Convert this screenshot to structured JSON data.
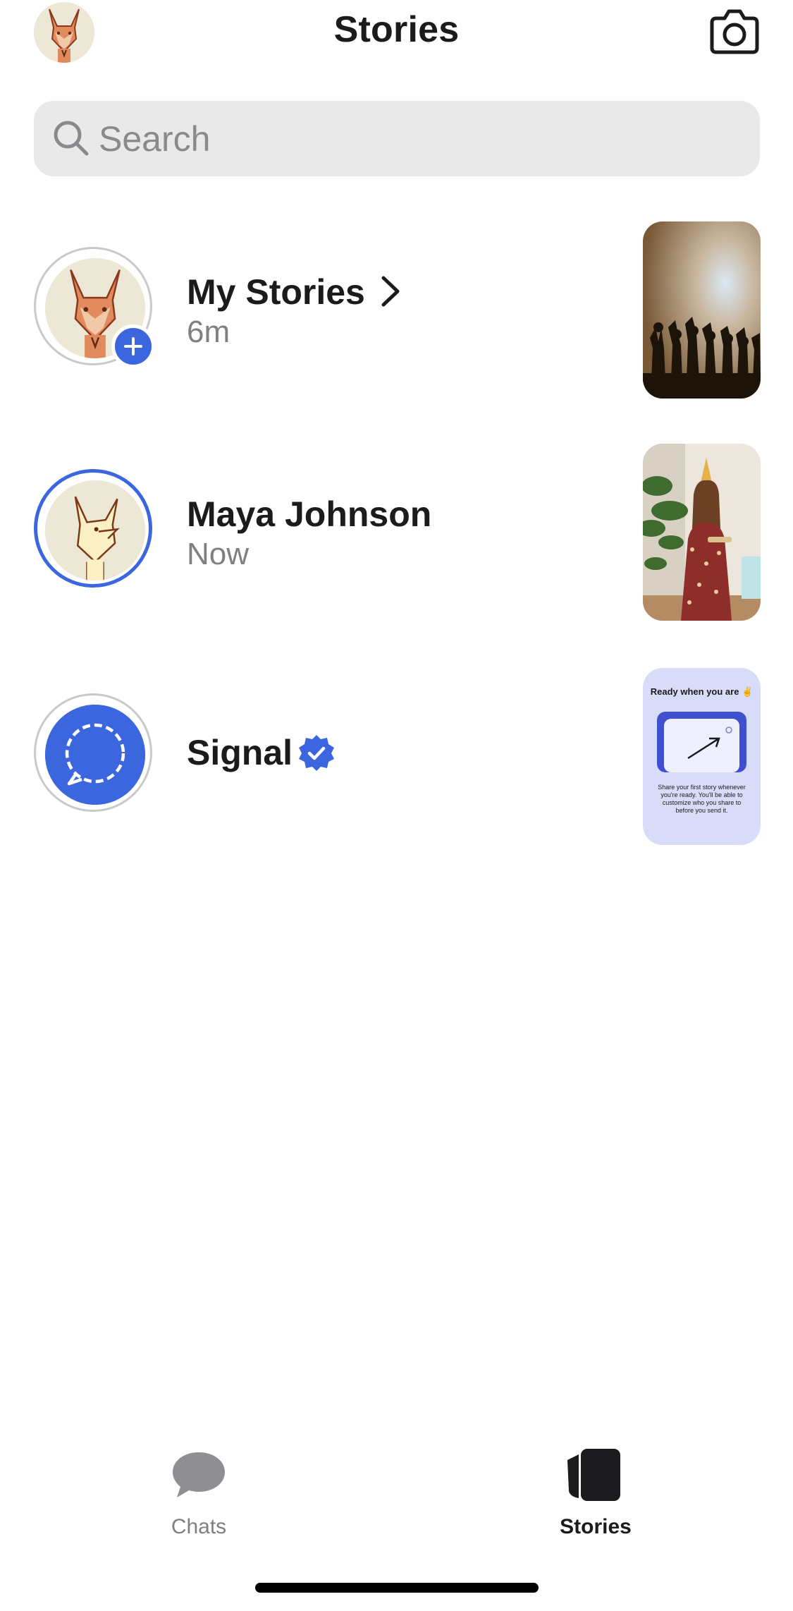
{
  "header": {
    "title": "Stories",
    "avatar_icon": "fox-avatar-icon",
    "camera_icon": "camera-icon"
  },
  "search": {
    "placeholder": "Search",
    "value": ""
  },
  "stories": [
    {
      "name": "My Stories",
      "time": "6m",
      "ring": "gray",
      "badge": "add",
      "thumb": "concert-silhouettes"
    },
    {
      "name": "Maya Johnson",
      "time": "Now",
      "ring": "blue",
      "thumb": "birthday-girl"
    },
    {
      "name": "Signal",
      "time": "",
      "ring": "gray",
      "verified": true,
      "thumb": "onboarding-card"
    }
  ],
  "signal_thumb": {
    "title": "Ready when you are ✌️",
    "body_lines": [
      "Share your first story whenever",
      "you're ready. You'll be able to",
      "customize who you share to",
      "before you send it."
    ]
  },
  "tabs": [
    {
      "label": "Chats",
      "active": false
    },
    {
      "label": "Stories",
      "active": true
    }
  ],
  "colors": {
    "accent": "#3b66dd",
    "search_bg": "#e9e9e9",
    "secondary_text": "#808084"
  }
}
